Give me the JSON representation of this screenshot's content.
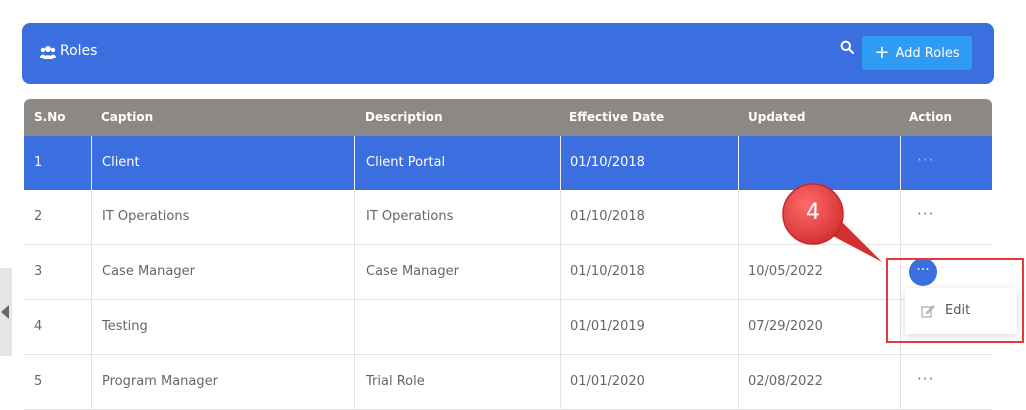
{
  "header": {
    "title": "Roles",
    "add_button_label": "Add Roles",
    "icons": {
      "roles": "users-icon",
      "search": "search-icon",
      "add": "plus-icon"
    }
  },
  "table": {
    "columns": [
      "S.No",
      "Caption",
      "Description",
      "Effective Date",
      "Updated",
      "Action"
    ],
    "rows": [
      {
        "sno": "1",
        "caption": "Client",
        "description": "Client Portal",
        "effective_date": "01/10/2018",
        "updated": ""
      },
      {
        "sno": "2",
        "caption": "IT Operations",
        "description": "IT Operations",
        "effective_date": "01/10/2018",
        "updated": ""
      },
      {
        "sno": "3",
        "caption": "Case Manager",
        "description": "Case Manager",
        "effective_date": "01/10/2018",
        "updated": "10/05/2022"
      },
      {
        "sno": "4",
        "caption": "Testing",
        "description": "",
        "effective_date": "01/01/2019",
        "updated": "07/29/2020"
      },
      {
        "sno": "5",
        "caption": "Program Manager",
        "description": "Trial Role",
        "effective_date": "01/01/2020",
        "updated": "02/08/2022"
      }
    ],
    "action_glyph": "···"
  },
  "action_menu": {
    "edit_label": "Edit"
  },
  "annotation": {
    "step": "4"
  },
  "colors": {
    "header_bg": "#3b6fe0",
    "button_bg": "#2f9bf2",
    "table_head": "#8c8885",
    "selected_row": "#3b6fe0",
    "callout": "#e53935"
  }
}
